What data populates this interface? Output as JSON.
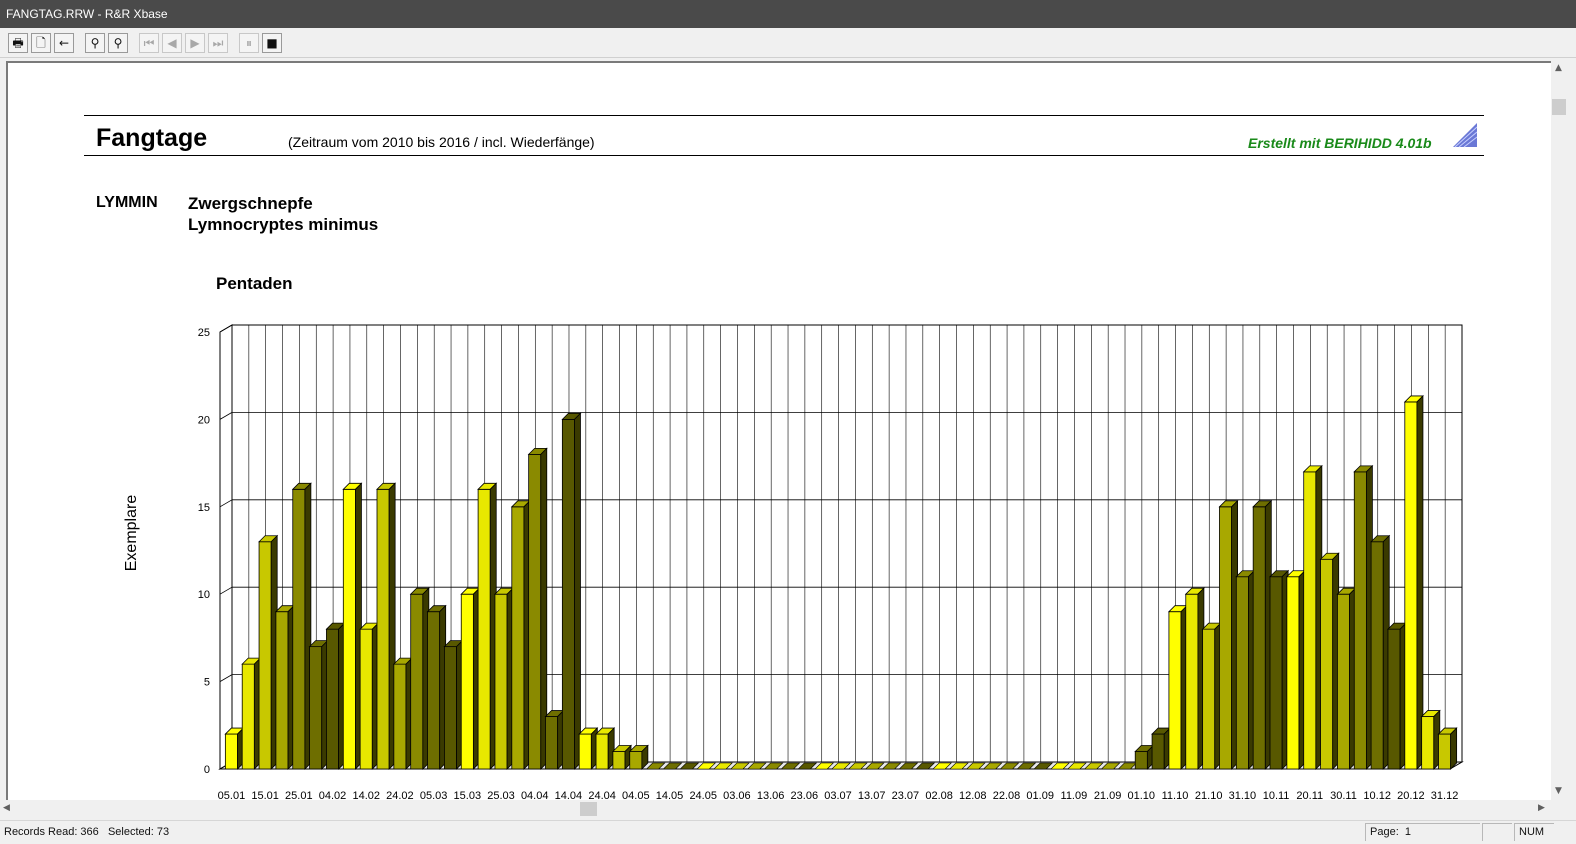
{
  "window": {
    "title": "FANGTAG.RRW - R&R Xbase"
  },
  "toolbar": {
    "buttons": [
      {
        "name": "print-icon",
        "glyph": "🖶"
      },
      {
        "name": "page-icon",
        "glyph": "🗋"
      },
      {
        "name": "back-arrow-icon",
        "glyph": "←"
      },
      {
        "name": "zoom-out-icon",
        "glyph": "⚲"
      },
      {
        "name": "zoom-in-icon",
        "glyph": "⚲"
      },
      {
        "name": "first-page-icon",
        "glyph": "⏮"
      },
      {
        "name": "prev-page-icon",
        "glyph": "◀"
      },
      {
        "name": "next-page-icon",
        "glyph": "▶"
      },
      {
        "name": "last-page-icon",
        "glyph": "⏭"
      },
      {
        "name": "pause-icon",
        "glyph": "⏸"
      },
      {
        "name": "stop-icon",
        "glyph": "■"
      }
    ]
  },
  "report": {
    "title": "Fangtage",
    "subtitle": "(Zeitraum vom 2010 bis 2016 / incl. Wiederfänge)",
    "credit": "Erstellt mit BERIHIDD 4.01b",
    "species_code": "LYMMIN",
    "species_german": "Zwergschnepfe",
    "species_latin": "Lymnocryptes minimus"
  },
  "chart_data": {
    "type": "bar",
    "title": "Pentaden",
    "xlabel": "",
    "ylabel": "Exemplare",
    "ylim": [
      0,
      25
    ],
    "yticks": [
      0,
      5,
      10,
      15,
      20,
      25
    ],
    "grid": true,
    "x_tick_labels": [
      "05.01",
      "15.01",
      "25.01",
      "04.02",
      "14.02",
      "24.02",
      "05.03",
      "15.03",
      "25.03",
      "04.04",
      "14.04",
      "24.04",
      "04.05",
      "14.05",
      "24.05",
      "03.06",
      "13.06",
      "23.06",
      "03.07",
      "13.07",
      "23.07",
      "02.08",
      "12.08",
      "22.08",
      "01.09",
      "11.09",
      "21.09",
      "01.10",
      "11.10",
      "21.10",
      "31.10",
      "10.11",
      "20.11",
      "30.11",
      "10.12",
      "20.12",
      "31.12"
    ],
    "values": [
      2,
      6,
      13,
      9,
      16,
      7,
      8,
      16,
      8,
      16,
      6,
      10,
      9,
      7,
      10,
      16,
      10,
      15,
      18,
      3,
      20,
      2,
      2,
      1,
      1,
      0,
      0,
      0,
      0,
      0,
      0,
      0,
      0,
      0,
      0,
      0,
      0,
      0,
      0,
      0,
      0,
      0,
      0,
      0,
      0,
      0,
      0,
      0,
      0,
      0,
      0,
      0,
      0,
      0,
      1,
      2,
      9,
      10,
      8,
      15,
      11,
      15,
      11,
      11,
      17,
      12,
      10,
      17,
      13,
      8,
      21,
      3,
      2
    ],
    "colors": [
      "#ffff00",
      "#e8e800",
      "#c8c800",
      "#a8a800",
      "#8a8a00",
      "#6e6e00",
      "#585800"
    ]
  },
  "statusbar": {
    "records": "Records Read: 366   Selected: 73",
    "page": "Page:  1",
    "num": "NUM"
  }
}
